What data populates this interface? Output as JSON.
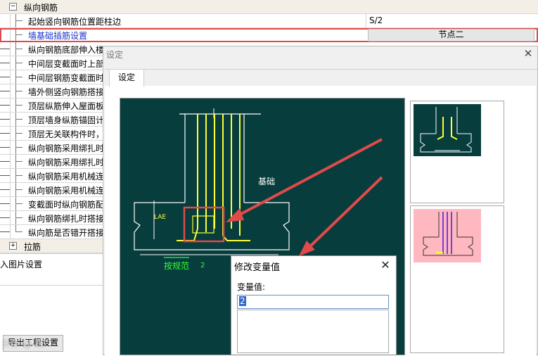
{
  "grid": {
    "header": "纵向钢筋",
    "rows": [
      {
        "label": "起始竖向钢筋位置距柱边",
        "value": "S/2"
      },
      {
        "label": "墙基础插筋设置",
        "value": "节点二"
      },
      {
        "label": "纵向钢筋底部伸入楼"
      },
      {
        "label": "中间层变截面时上部"
      },
      {
        "label": "中间层钢筋变截面时"
      },
      {
        "label": "墙外侧竖向钢筋搭接"
      },
      {
        "label": "顶层纵筋伸入屋面板"
      },
      {
        "label": "顶层墙身纵筋锚固计"
      },
      {
        "label": "顶层无关联构件时，"
      },
      {
        "label": "纵向钢筋采用绑扎时"
      },
      {
        "label": "纵向钢筋采用绑扎时"
      },
      {
        "label": "纵向钢筋采用机械连"
      },
      {
        "label": "纵向钢筋采用机械连"
      },
      {
        "label": "变截面时纵向钢筋配"
      },
      {
        "label": "纵向钢筋绑扎时搭接"
      },
      {
        "label": "纵向筋是否错开搭接"
      }
    ],
    "next_header": "拉筋"
  },
  "lower_panel": {
    "label": "入图片设置",
    "export_button": "导出工程设置"
  },
  "settings_dialog": {
    "title": "设定",
    "tab": "设定",
    "close_icon": "close-icon",
    "drawing": {
      "foundation_label": "基础",
      "lae_label": "LAE",
      "spec_label": "按规范",
      "dim_label": "2"
    }
  },
  "modify_dialog": {
    "title": "修改变量值",
    "field_label": "变量值:",
    "value": "2",
    "close_icon": "close-icon"
  },
  "watermark": "头条 @ 筑",
  "colors": {
    "canvas_bg": "#073d3d",
    "rebar": "#ffff33",
    "outline": "#ffffff",
    "annotation": "#33ff33",
    "highlight": "#e04a4a",
    "thumb2_bg": "#ffb8c0"
  }
}
